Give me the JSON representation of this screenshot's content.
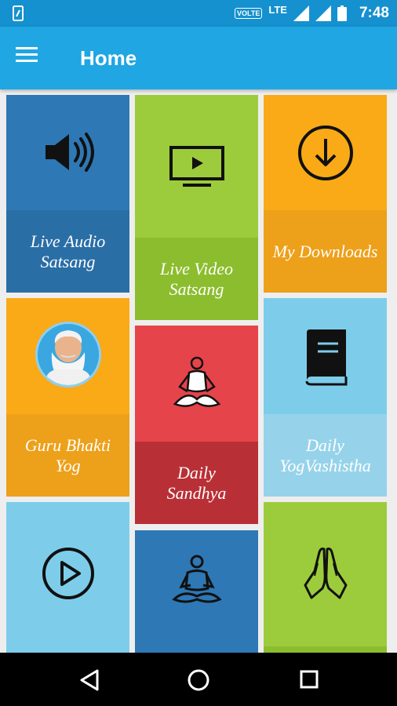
{
  "status_bar": {
    "volte": "VOLTE",
    "network": "LTE",
    "time": "7:48"
  },
  "app_bar": {
    "title": "Home"
  },
  "tiles": [
    {
      "label_line1": "Live Audio",
      "label_line2": "Satsang",
      "icon": "speaker-icon",
      "top_color": "#2e78b5",
      "bottom_color": "#2a6ea6"
    },
    {
      "label_line1": "Live Video",
      "label_line2": "Satsang",
      "icon": "tv-play-icon",
      "top_color": "#9ccc3c",
      "bottom_color": "#8cbd2e"
    },
    {
      "label_line1": "My Downloads",
      "label_line2": "",
      "icon": "download-icon",
      "top_color": "#f9aa16",
      "bottom_color": "#eda01a"
    },
    {
      "label_line1": "Guru Bhakti",
      "label_line2": "Yog",
      "icon": "guru-avatar",
      "top_color": "#f9aa16",
      "bottom_color": "#eda01a"
    },
    {
      "label_line1": "Daily",
      "label_line2": "Sandhya",
      "icon": "meditation-icon",
      "top_color": "#e5444a",
      "bottom_color": "#b83036"
    },
    {
      "label_line1": "Daily",
      "label_line2": "YogVashistha",
      "icon": "book-icon",
      "top_color": "#7dcdea",
      "bottom_color": "#96d3ea"
    },
    {
      "label_line1": "",
      "label_line2": "",
      "icon": "play-circle-icon",
      "top_color": "#7dcdea",
      "bottom_color": "#7dcdea"
    },
    {
      "label_line1": "",
      "label_line2": "",
      "icon": "yoga-pose-icon",
      "top_color": "#2e78b5",
      "bottom_color": "#2e78b5"
    },
    {
      "label_line1": "",
      "label_line2": "",
      "icon": "praying-hands-icon",
      "top_color": "#9ccc3c",
      "bottom_color": "#8cbd2e"
    }
  ]
}
